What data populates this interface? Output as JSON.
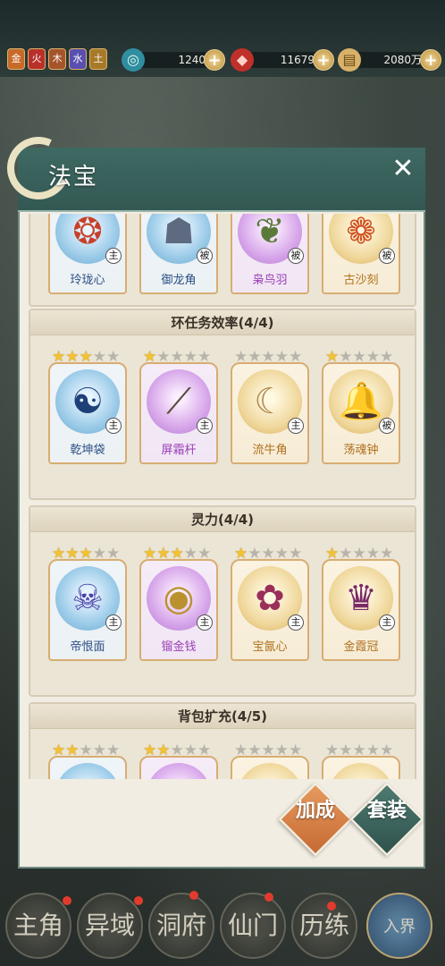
{
  "topbar": {
    "badges": [
      {
        "char": "金",
        "color": "#c86a2a"
      },
      {
        "char": "火",
        "color": "#b8302a"
      },
      {
        "char": "木",
        "color": "#a6542c"
      },
      {
        "char": "水",
        "color": "#5a4fb0"
      },
      {
        "char": "土",
        "color": "#a77a2a"
      }
    ],
    "resources": [
      {
        "icon": "spiral-coin-icon",
        "glyph": "◎",
        "value": "1240"
      },
      {
        "icon": "red-crystal-icon",
        "glyph": "◆",
        "value": "11679"
      },
      {
        "icon": "scroll-icon",
        "glyph": "▤",
        "value": "2080万"
      }
    ],
    "plus": "+"
  },
  "modal": {
    "title": "法宝",
    "close": "✕",
    "sections": [
      {
        "title": "",
        "items": [
          {
            "name": "玲珑心",
            "tag": "主",
            "rarity": "blue",
            "stars": null,
            "art": "❂"
          },
          {
            "name": "御龙角",
            "tag": "被",
            "rarity": "blue",
            "stars": null,
            "art": "☗"
          },
          {
            "name": "枭鸟羽",
            "tag": "被",
            "rarity": "purple",
            "stars": null,
            "art": "❦"
          },
          {
            "name": "古沙刻",
            "tag": "被",
            "rarity": "gold",
            "stars": null,
            "art": "❁"
          }
        ]
      },
      {
        "title": "环任务效率(4/4)",
        "items": [
          {
            "name": "乾坤袋",
            "tag": "主",
            "rarity": "blue",
            "stars": 3,
            "art": "☯"
          },
          {
            "name": "屏霜杆",
            "tag": "主",
            "rarity": "purple",
            "stars": 1,
            "art": "⟋"
          },
          {
            "name": "流牛角",
            "tag": "主",
            "rarity": "gold",
            "stars": 0,
            "art": "☾"
          },
          {
            "name": "荡魂钟",
            "tag": "被",
            "rarity": "gold",
            "stars": 1,
            "art": "🔔"
          }
        ]
      },
      {
        "title": "灵力(4/4)",
        "items": [
          {
            "name": "帝恨面",
            "tag": "主",
            "rarity": "blue",
            "stars": 3,
            "art": "☠"
          },
          {
            "name": "镏金钱",
            "tag": "主",
            "rarity": "purple",
            "stars": 3,
            "art": "◉"
          },
          {
            "name": "宝氤心",
            "tag": "主",
            "rarity": "gold",
            "stars": 1,
            "art": "✿"
          },
          {
            "name": "金霞冠",
            "tag": "主",
            "rarity": "gold",
            "stars": 1,
            "art": "♛"
          }
        ]
      },
      {
        "title": "背包扩充(4/5)",
        "items": [
          {
            "name": "",
            "tag": "",
            "rarity": "blue",
            "stars": 2,
            "art": ""
          },
          {
            "name": "",
            "tag": "",
            "rarity": "purple",
            "stars": 2,
            "art": ""
          },
          {
            "name": "",
            "tag": "",
            "rarity": "gold",
            "stars": 0,
            "art": ""
          },
          {
            "name": "",
            "tag": "",
            "rarity": "gold",
            "stars": 0,
            "art": ""
          }
        ]
      }
    ],
    "actions": {
      "bonus_label": "加成",
      "set_label": "套装"
    }
  },
  "bottom_nav": [
    {
      "label": "主角",
      "dot": true
    },
    {
      "label": "异域",
      "dot": true
    },
    {
      "label": "洞府",
      "dot": true
    },
    {
      "label": "仙门",
      "dot": true
    },
    {
      "label": "历练",
      "dot": true
    },
    {
      "label": "入界",
      "dot": false
    }
  ],
  "colors": {
    "header": "#3f6963",
    "bonus_button": "#d9824a",
    "set_button": "#3f6963",
    "star_on": "#f2c232",
    "star_off": "#b9b4aa"
  }
}
